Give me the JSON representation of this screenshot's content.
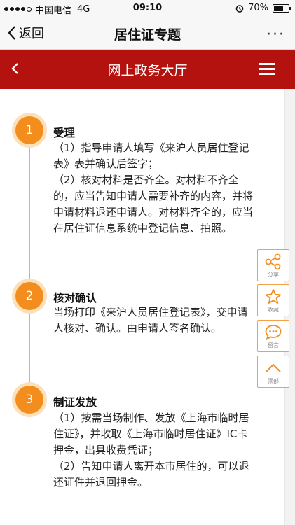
{
  "status_bar": {
    "carrier": "中国电信",
    "network": "4G",
    "time": "09:10",
    "battery": "70%",
    "battery_level": 0.7
  },
  "nav": {
    "back_label": "返回",
    "title": "居住证专题",
    "more": "···"
  },
  "header": {
    "title": "网上政务大厅"
  },
  "steps": [
    {
      "number": "1",
      "title": "受理",
      "lines": [
        "（1）指导申请人填写《来沪人员居住登记表》表并确认后签字；",
        "（2）核对材料是否齐全。对材料不齐全的，应当告知申请人需要补齐的内容，并将申请材料退还申请人。对材料齐全的，应当在居住证信息系统中登记信息、拍照。"
      ]
    },
    {
      "number": "2",
      "title": "核对确认",
      "lines": [
        "当场打印《来沪人员居住登记表》，交申请人核对、确认。由申请人签名确认。"
      ]
    },
    {
      "number": "3",
      "title": "制证发放",
      "lines": [
        "（1）按需当场制作、发放《上海市临时居住证》，并收取《上海市临时居住证》IC卡押金，出具收费凭证；",
        "（2）告知申请人离开本市居住的，可以退还证件并退回押金。"
      ]
    }
  ],
  "side_actions": {
    "share": "分享",
    "favorite": "收藏",
    "message": "留言",
    "top": "顶部"
  },
  "colors": {
    "header_red": "#b4120f",
    "accent_orange": "#f28d1e"
  }
}
